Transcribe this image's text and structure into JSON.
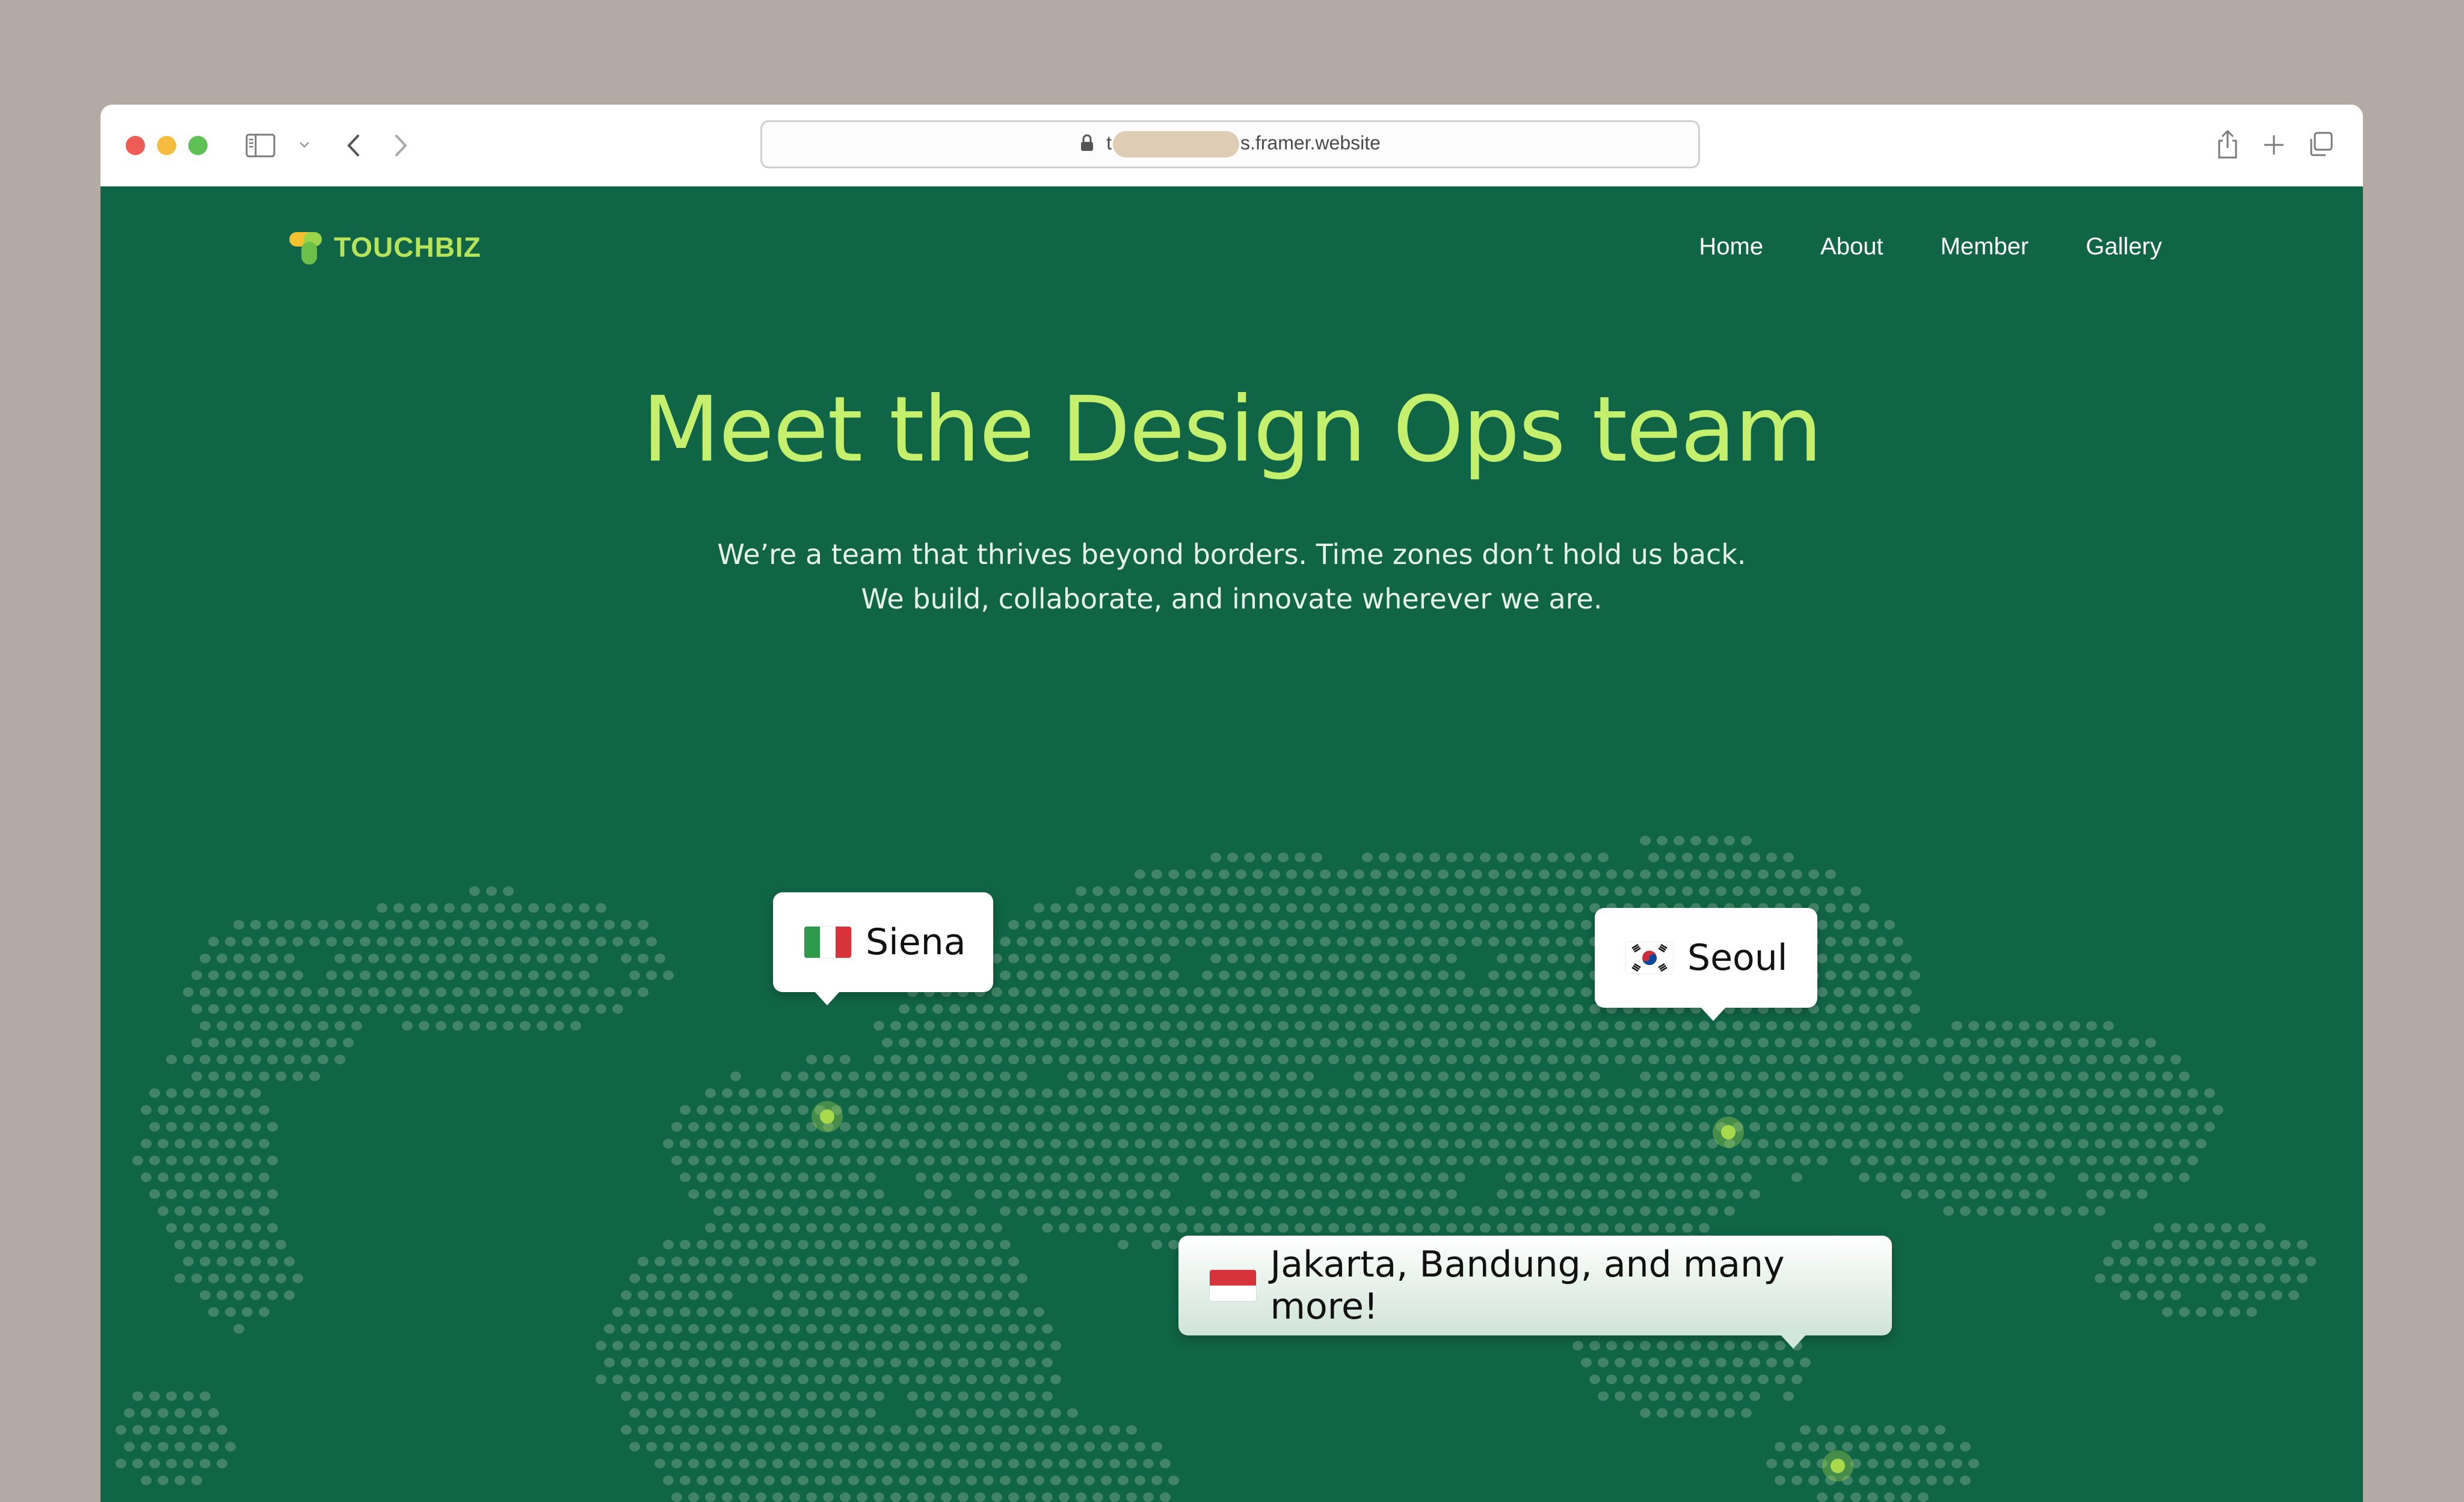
{
  "browser": {
    "url_prefix": "t",
    "url_suffix": "s.framer.website"
  },
  "site": {
    "logo_text": "TOUCHBIZ",
    "nav": [
      "Home",
      "About",
      "Member",
      "Gallery"
    ]
  },
  "hero": {
    "title": "Meet the Design Ops team",
    "subtitle_line1": "We’re a team that thrives beyond borders. Time zones don’t hold us back.",
    "subtitle_line2": "We build, collaborate, and innovate wherever we are."
  },
  "locations": {
    "siena": {
      "label": "Siena",
      "flag": "italy-flag"
    },
    "seoul": {
      "label": "Seoul",
      "flag": "south-korea-flag"
    },
    "jakarta": {
      "label": "Jakarta, Bandung, and many more!",
      "flag": "indonesia-flag"
    }
  },
  "colors": {
    "page_bg": "#116547",
    "accent": "#c4f06e",
    "dot": "#4f8c72",
    "pin": "#a7d94a"
  }
}
